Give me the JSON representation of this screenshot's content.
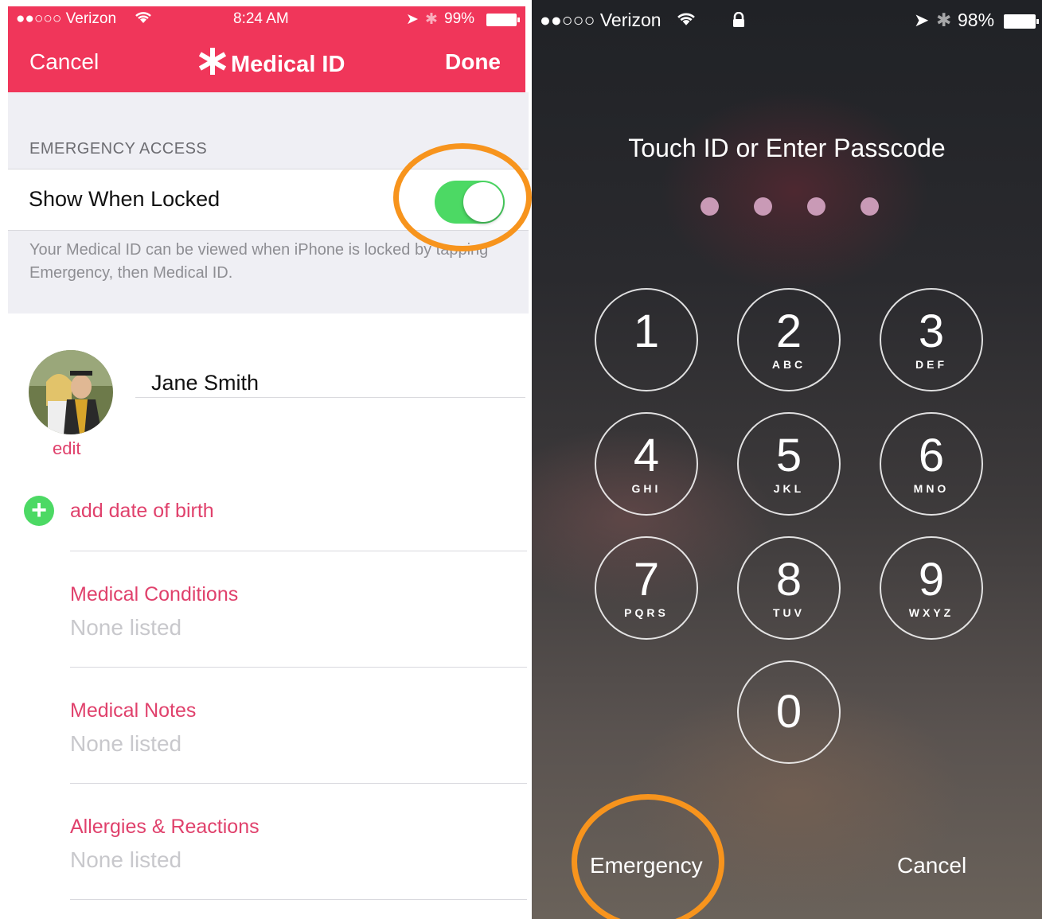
{
  "left_panel": {
    "status": {
      "carrier": "●●○○○ Verizon",
      "time": "8:24 AM",
      "battery": "99%"
    },
    "nav": {
      "cancel": "Cancel",
      "title": "Medical ID",
      "done": "Done"
    },
    "section_header": "EMERGENCY ACCESS",
    "toggle": {
      "label": "Show When Locked",
      "on": true
    },
    "footer_note": "Your Medical ID can be viewed when iPhone is locked by tapping Emergency, then Medical ID.",
    "profile": {
      "name": "Jane Smith",
      "edit": "edit"
    },
    "add_dob": "add date of birth",
    "fields": [
      {
        "title": "Medical Conditions",
        "value": "None listed"
      },
      {
        "title": "Medical Notes",
        "value": "None listed"
      },
      {
        "title": "Allergies & Reactions",
        "value": "None listed"
      }
    ]
  },
  "right_panel": {
    "status": {
      "carrier": "●●○○○ Verizon",
      "battery": "98%"
    },
    "title": "Touch ID or Enter Passcode",
    "keys": [
      {
        "digit": "1",
        "letters": ""
      },
      {
        "digit": "2",
        "letters": "ABC"
      },
      {
        "digit": "3",
        "letters": "DEF"
      },
      {
        "digit": "4",
        "letters": "GHI"
      },
      {
        "digit": "5",
        "letters": "JKL"
      },
      {
        "digit": "6",
        "letters": "MNO"
      },
      {
        "digit": "7",
        "letters": "PQRS"
      },
      {
        "digit": "8",
        "letters": "TUV"
      },
      {
        "digit": "9",
        "letters": "WXYZ"
      },
      {
        "digit": "0",
        "letters": ""
      }
    ],
    "emergency": "Emergency",
    "cancel": "Cancel"
  },
  "colors": {
    "accent": "#f0365a",
    "highlight": "#f7941d",
    "toggle_on": "#4cd964",
    "link": "#e0416c"
  }
}
